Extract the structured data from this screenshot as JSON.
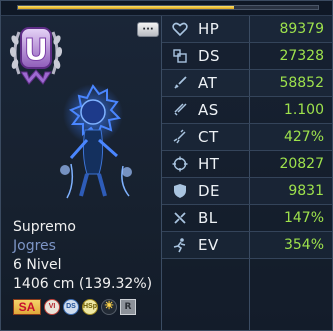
{
  "top_bar": {
    "progress": 0.72,
    "progress_color": "#f2c230"
  },
  "emblem": {
    "letter": "U",
    "icon": "rank-emblem-icon"
  },
  "chat_button": {
    "label": "···",
    "icon": "chat-bubble-icon"
  },
  "character": {
    "name": "Supremo",
    "clan": "Jogres",
    "level": "6 Nivel",
    "height": "1406 cm (139.32%)"
  },
  "badges": [
    "SA",
    "VI",
    "DS",
    "HSp",
    "☀",
    "R"
  ],
  "stats": [
    {
      "label": "HP",
      "value": "89379",
      "icon": "heart-icon"
    },
    {
      "label": "DS",
      "value": "27328",
      "icon": "digisoul-icon"
    },
    {
      "label": "AT",
      "value": "58852",
      "icon": "sword-icon"
    },
    {
      "label": "AS",
      "value": "1.100",
      "icon": "attack-speed-icon"
    },
    {
      "label": "CT",
      "value": "427%",
      "icon": "critical-icon"
    },
    {
      "label": "HT",
      "value": "20827",
      "icon": "crosshair-icon"
    },
    {
      "label": "DE",
      "value": "9831",
      "icon": "shield-icon"
    },
    {
      "label": "BL",
      "value": "147%",
      "icon": "block-icon"
    },
    {
      "label": "EV",
      "value": "354%",
      "icon": "evade-icon"
    }
  ],
  "colors": {
    "value_green": "#9ee24c",
    "clan_blue": "#7d95c6",
    "panel_bg": "#17212f"
  }
}
